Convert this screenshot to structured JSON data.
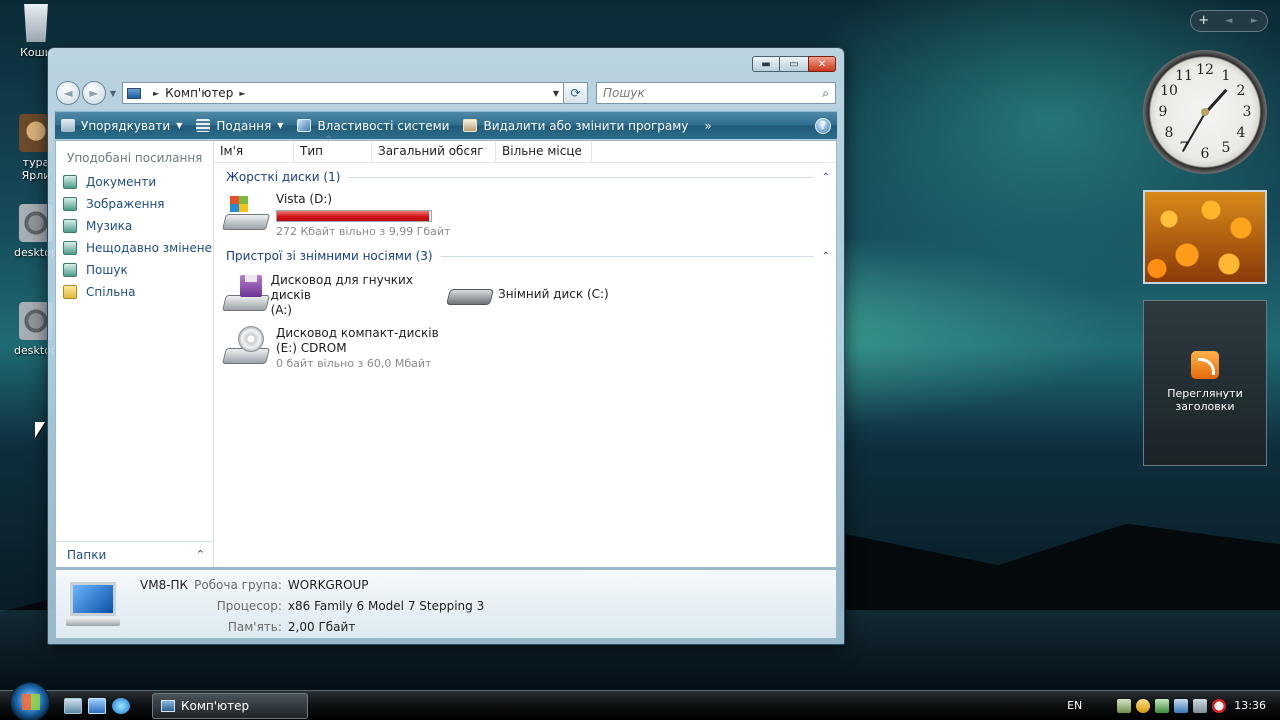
{
  "desktop": {
    "icons": [
      {
        "label": "Коши"
      },
      {
        "label": "тура"
      },
      {
        "label": "Ярли"
      },
      {
        "label": "desktop"
      },
      {
        "label": "desktop"
      }
    ]
  },
  "gadgets": {
    "toolbar_add": "+",
    "toolbar_prev": "◄",
    "toolbar_next": "►",
    "clock_numbers": [
      "12",
      "1",
      "2",
      "3",
      "4",
      "5",
      "6",
      "7",
      "8",
      "9",
      "10",
      "11"
    ],
    "feed_label": "Переглянути заголовки"
  },
  "window": {
    "buttons": {
      "minimize": "▬",
      "maximize": "▭",
      "close": "✕"
    },
    "nav": {
      "back": "◄",
      "forward": "►",
      "recent": "▼"
    },
    "address": {
      "crumb": "Комп'ютер",
      "arrow": "►",
      "dropdown": "▼"
    },
    "refresh": "⟳",
    "search": {
      "placeholder": "Пошук",
      "icon": "⌕"
    },
    "toolbar": {
      "organize": "Упорядкувати",
      "views": "Подання",
      "system_properties": "Властивості системи",
      "uninstall": "Видалити або змінити програму",
      "more": "»",
      "help": "?",
      "caret": "▼"
    },
    "navpane": {
      "title": "Уподобані посилання",
      "links": [
        "Документи",
        "Зображення",
        "Музика",
        "Нещодавно змінене",
        "Пошук",
        "Спільна"
      ],
      "folders": "Папки",
      "folders_chevron": "⌃"
    },
    "columns": [
      "Ім'я",
      "Тип",
      "Загальний обсяг",
      "Вільне місце"
    ],
    "groups": {
      "hard_disks": "Жорсткі диски (1)",
      "removable": "Пристрої зі знімними носіями (3)",
      "collapse": "⌃"
    },
    "drives": {
      "vista": {
        "name": "Vista (D:)",
        "free": "272 Кбайт вільно з 9,99 Гбайт",
        "used_fraction": 0.99
      },
      "floppy": {
        "name_line1": "Дисковод для гнучких дисків",
        "name_line2": "(A:)"
      },
      "removable": {
        "name": "Знімний диск (C:)"
      },
      "cdrom": {
        "name_line1": "Дисковод компакт-дисків",
        "name_line2": "(E:) CDROM",
        "free": "0 байт вільно з 60,0 Мбайт"
      }
    },
    "details": {
      "pc_name": "VM8-ПК",
      "workgroup_label": "Робоча група:",
      "workgroup_value": "WORKGROUP",
      "cpu_label": "Процесор:",
      "cpu_value": "x86 Family 6 Model 7 Stepping 3",
      "memory_label": "Пам'ять:",
      "memory_value": "2,00 Гбайт"
    }
  },
  "taskbar": {
    "task_label": "Комп'ютер",
    "language": "EN",
    "time": "13:36"
  }
}
